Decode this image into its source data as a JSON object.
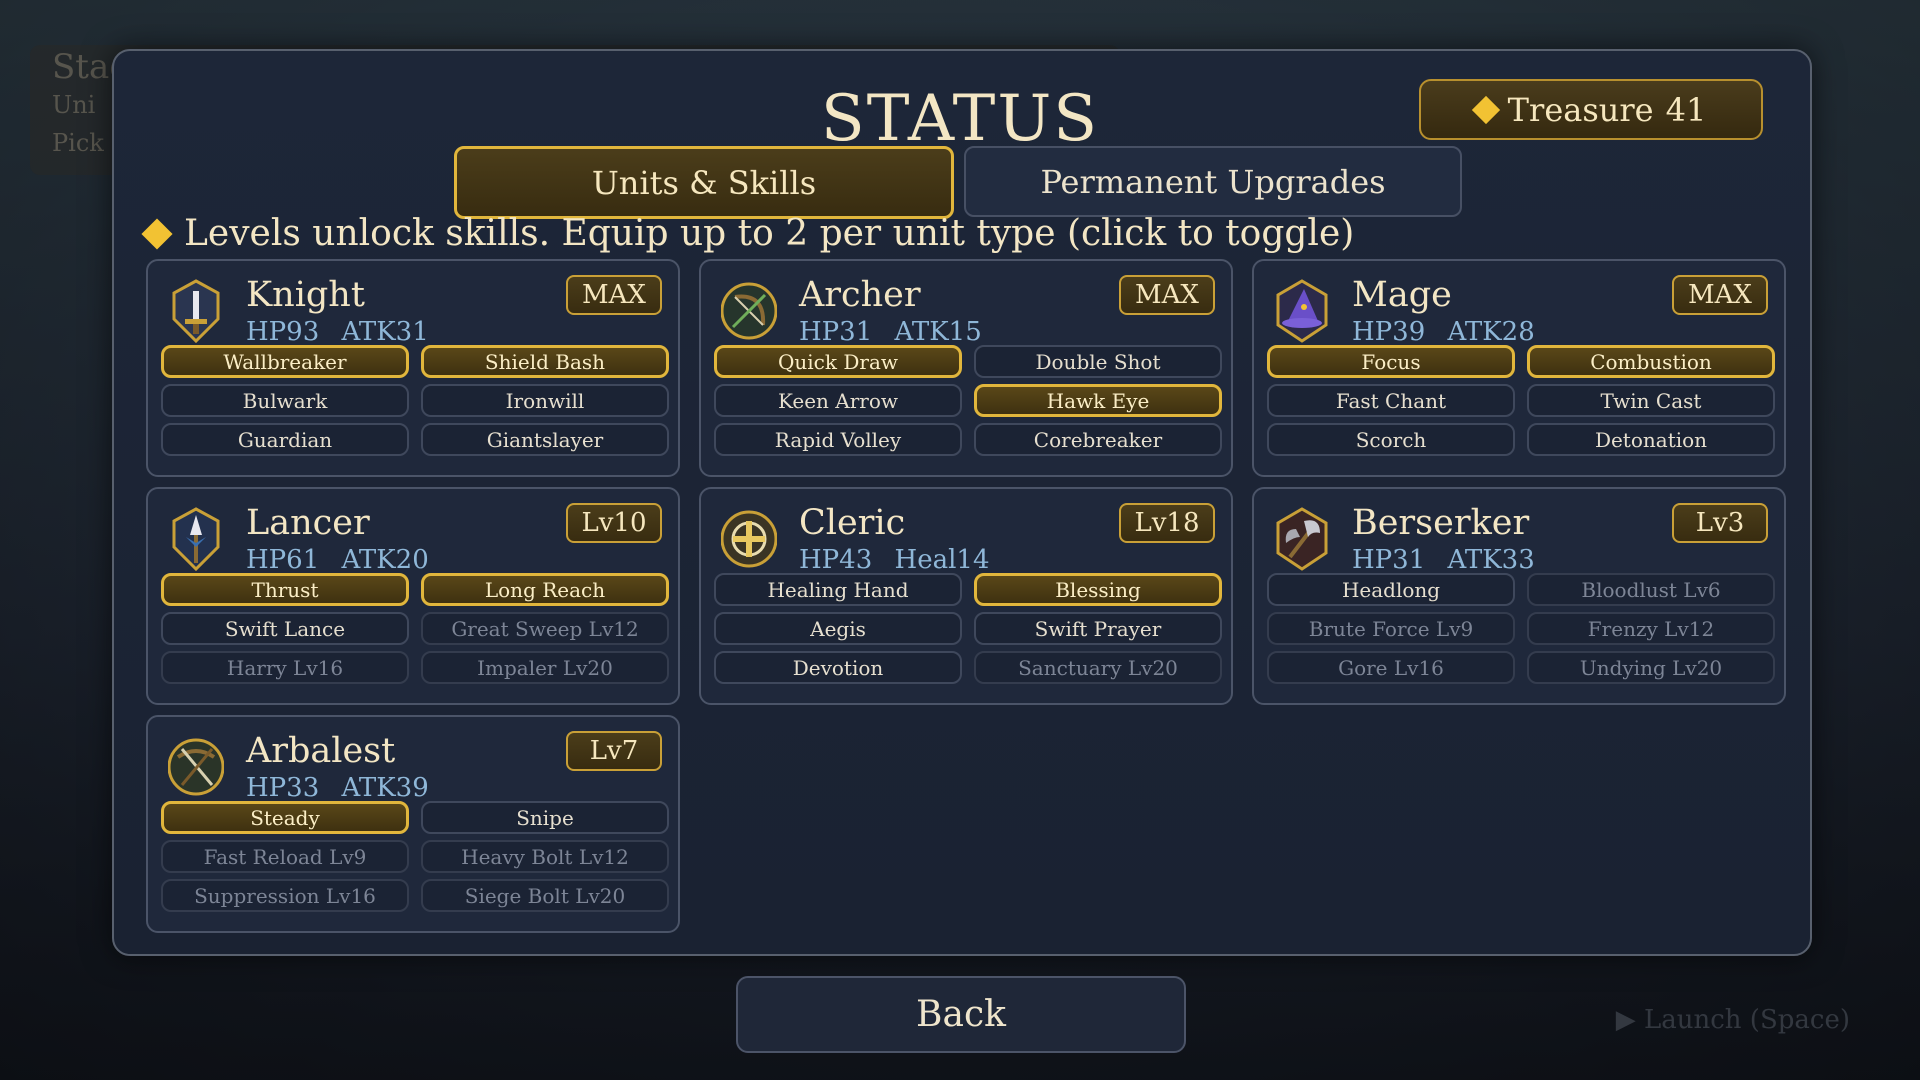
{
  "background": {
    "stage_text": "Stag",
    "line2": "Uni",
    "line3": "Pick",
    "launch": "▶ Launch (Space)"
  },
  "header": {
    "title": "STATUS",
    "treasure_label": "Treasure",
    "treasure_value": "41"
  },
  "tabs": [
    {
      "label": "Units & Skills",
      "active": true
    },
    {
      "label": "Permanent Upgrades",
      "active": false
    }
  ],
  "hint": "Levels unlock skills. Equip up to 2 per unit type (click to toggle)",
  "units": [
    {
      "name": "Knight",
      "hp": "HP93",
      "atk": "ATK31",
      "level": "MAX",
      "icon": "sword-shield-icon",
      "skills": [
        {
          "label": "Wallbreaker",
          "state": "on"
        },
        {
          "label": "Shield Bash",
          "state": "on"
        },
        {
          "label": "Bulwark",
          "state": "off"
        },
        {
          "label": "Ironwill",
          "state": "off"
        },
        {
          "label": "Guardian",
          "state": "off"
        },
        {
          "label": "Giantslayer",
          "state": "off"
        }
      ]
    },
    {
      "name": "Archer",
      "hp": "HP31",
      "atk": "ATK15",
      "level": "MAX",
      "icon": "bow-icon",
      "skills": [
        {
          "label": "Quick Draw",
          "state": "on"
        },
        {
          "label": "Double Shot",
          "state": "off"
        },
        {
          "label": "Keen Arrow",
          "state": "off"
        },
        {
          "label": "Hawk Eye",
          "state": "on"
        },
        {
          "label": "Rapid Volley",
          "state": "off"
        },
        {
          "label": "Corebreaker",
          "state": "off"
        }
      ]
    },
    {
      "name": "Mage",
      "hp": "HP39",
      "atk": "ATK28",
      "level": "MAX",
      "icon": "wizard-hat-icon",
      "skills": [
        {
          "label": "Focus",
          "state": "on"
        },
        {
          "label": "Combustion",
          "state": "on"
        },
        {
          "label": "Fast Chant",
          "state": "off"
        },
        {
          "label": "Twin Cast",
          "state": "off"
        },
        {
          "label": "Scorch",
          "state": "off"
        },
        {
          "label": "Detonation",
          "state": "off"
        }
      ]
    },
    {
      "name": "Lancer",
      "hp": "HP61",
      "atk": "ATK20",
      "level": "Lv10",
      "icon": "lance-icon",
      "skills": [
        {
          "label": "Thrust",
          "state": "on"
        },
        {
          "label": "Long Reach",
          "state": "on"
        },
        {
          "label": "Swift Lance",
          "state": "off"
        },
        {
          "label": "Great Sweep Lv12",
          "state": "locked"
        },
        {
          "label": "Harry Lv16",
          "state": "locked"
        },
        {
          "label": "Impaler Lv20",
          "state": "locked"
        }
      ]
    },
    {
      "name": "Cleric",
      "hp": "HP43",
      "atk": "Heal14",
      "level": "Lv18",
      "icon": "holy-cross-icon",
      "skills": [
        {
          "label": "Healing Hand",
          "state": "off"
        },
        {
          "label": "Blessing",
          "state": "on"
        },
        {
          "label": "Aegis",
          "state": "off"
        },
        {
          "label": "Swift Prayer",
          "state": "off"
        },
        {
          "label": "Devotion",
          "state": "off"
        },
        {
          "label": "Sanctuary Lv20",
          "state": "locked"
        }
      ]
    },
    {
      "name": "Berserker",
      "hp": "HP31",
      "atk": "ATK33",
      "level": "Lv3",
      "icon": "axe-icon",
      "skills": [
        {
          "label": "Headlong",
          "state": "off"
        },
        {
          "label": "Bloodlust Lv6",
          "state": "locked"
        },
        {
          "label": "Brute Force Lv9",
          "state": "locked"
        },
        {
          "label": "Frenzy Lv12",
          "state": "locked"
        },
        {
          "label": "Gore Lv16",
          "state": "locked"
        },
        {
          "label": "Undying Lv20",
          "state": "locked"
        }
      ]
    },
    {
      "name": "Arbalest",
      "hp": "HP33",
      "atk": "ATK39",
      "level": "Lv7",
      "icon": "crossbow-icon",
      "skills": [
        {
          "label": "Steady",
          "state": "on"
        },
        {
          "label": "Snipe",
          "state": "off"
        },
        {
          "label": "Fast Reload Lv9",
          "state": "locked"
        },
        {
          "label": "Heavy Bolt Lv12",
          "state": "locked"
        },
        {
          "label": "Suppression Lv16",
          "state": "locked"
        },
        {
          "label": "Siege Bolt Lv20",
          "state": "locked"
        }
      ]
    }
  ],
  "footer": {
    "back_label": "Back"
  },
  "colors": {
    "accent_gold": "#e1b63c",
    "panel": "#1d2638",
    "stat_blue": "#8fb7d8"
  }
}
